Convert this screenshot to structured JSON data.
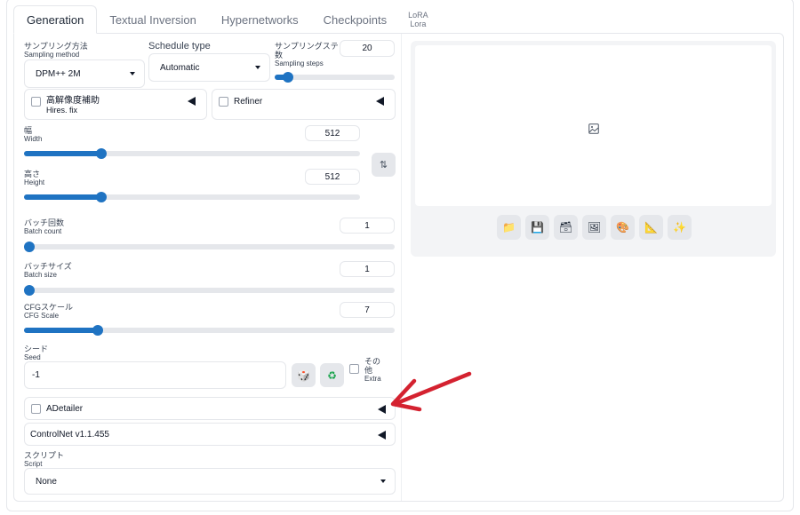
{
  "tabs": [
    {
      "label": "Generation"
    },
    {
      "label": "Textual Inversion"
    },
    {
      "label": "Hypernetworks"
    },
    {
      "label": "Checkpoints"
    },
    {
      "label": "LoRA",
      "sublabel": "Lora"
    }
  ],
  "sampler": {
    "label_jp": "サンプリング方法",
    "label_en": "Sampling method",
    "value": "DPM++ 2M"
  },
  "schedule": {
    "label": "Schedule type",
    "value": "Automatic"
  },
  "steps": {
    "label_jp1": "サンプリングステップ",
    "label_jp2": "数",
    "label_en": "Sampling steps",
    "value": "20",
    "fill_fraction": 0.11
  },
  "hires": {
    "label_jp": "高解像度補助",
    "label_en": "Hires. fix"
  },
  "refiner": {
    "label": "Refiner"
  },
  "width": {
    "label_jp": "幅",
    "label_en": "Width",
    "value": "512",
    "fill_fraction": 0.23
  },
  "height": {
    "label_jp": "高さ",
    "label_en": "Height",
    "value": "512",
    "fill_fraction": 0.23
  },
  "swap_icon": "swap-vertical-icon",
  "batch_count": {
    "label_jp": "バッチ回数",
    "label_en": "Batch count",
    "value": "1",
    "fill_fraction": 0.0
  },
  "batch_size": {
    "label_jp": "バッチサイズ",
    "label_en": "Batch size",
    "value": "1",
    "fill_fraction": 0.0
  },
  "cfg": {
    "label_jp": "CFGスケール",
    "label_en": "CFG Scale",
    "value": "7",
    "fill_fraction": 0.2
  },
  "seed": {
    "label_jp": "シード",
    "label_en": "Seed",
    "value": "-1",
    "dice_icon": "dice-icon",
    "recycle_icon": "recycle-icon"
  },
  "extra": {
    "label_jp1": "その",
    "label_jp2": "他",
    "label_en": "Extra"
  },
  "adetailer": {
    "label": "ADetailer"
  },
  "controlnet": {
    "label": "ControlNet v1.1.455"
  },
  "script": {
    "label_jp": "スクリプト",
    "label_en": "Script",
    "value": "None"
  },
  "output_tools": [
    {
      "name": "folder-icon",
      "glyph": "📁"
    },
    {
      "name": "save-icon",
      "glyph": "💾"
    },
    {
      "name": "zip-icon",
      "glyph": "🗃"
    },
    {
      "name": "image-icon",
      "glyph": "🖼"
    },
    {
      "name": "palette-icon",
      "glyph": "🎨"
    },
    {
      "name": "triangle-ruler-icon",
      "glyph": "📐"
    },
    {
      "name": "sparkle-icon",
      "glyph": "✨"
    }
  ],
  "colors": {
    "accent": "#1f73c2",
    "arrow": "#d42230"
  }
}
